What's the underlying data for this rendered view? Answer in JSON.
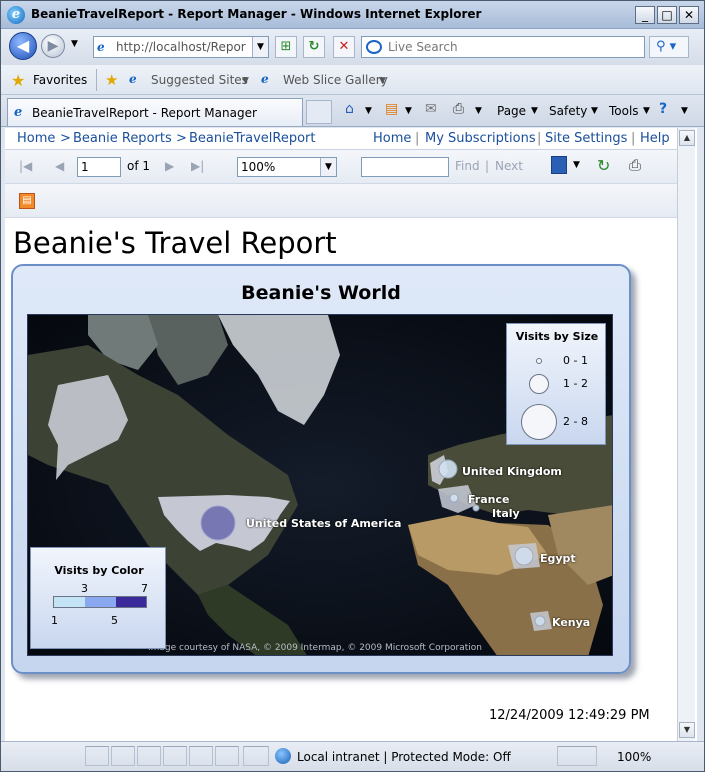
{
  "window": {
    "title": "BeanieTravelReport - Report Manager - Windows Internet Explorer"
  },
  "address_bar": {
    "url": "http://localhost/Reports,",
    "search_placeholder": "Live Search"
  },
  "favorites_bar": {
    "favorites_label": "Favorites",
    "links": [
      "Suggested Sites",
      "Web Slice Gallery"
    ]
  },
  "tab": {
    "label": "BeanieTravelReport - Report Manager"
  },
  "command_bar": {
    "page": "Page",
    "safety": "Safety",
    "tools": "Tools"
  },
  "report_manager": {
    "breadcrumb": [
      "Home",
      "Beanie Reports",
      "BeanieTravelReport"
    ],
    "breadcrumb_sep": ">",
    "links": [
      "Home",
      "My Subscriptions",
      "Site Settings",
      "Help"
    ]
  },
  "report_toolbar": {
    "page_number": "1",
    "page_of": "of 1",
    "zoom": "100%",
    "find": "Find",
    "next": "Next"
  },
  "report": {
    "title": "Beanie's Travel Report",
    "map_title": "Beanie's World",
    "countries": [
      {
        "name": "United States of America"
      },
      {
        "name": "United Kingdom"
      },
      {
        "name": "France"
      },
      {
        "name": "Italy"
      },
      {
        "name": "Egypt"
      },
      {
        "name": "Kenya"
      }
    ],
    "legend_size": {
      "title": "Visits by Size",
      "ranges": [
        "0 - 1",
        "1 - 2",
        "2 - 8"
      ]
    },
    "legend_color": {
      "title": "Visits by Color",
      "ticks_top": [
        "3",
        "7"
      ],
      "ticks_bottom": [
        "1",
        "5"
      ],
      "colors": [
        "#c4e3f4",
        "#8aa8ef",
        "#3a2a9a"
      ]
    },
    "credit": "Image courtesy of NASA, © 2009 Intermap, © 2009 Microsoft Corporation",
    "timestamp": "12/24/2009 12:49:29 PM"
  },
  "status_bar": {
    "zone": "Local intranet | Protected Mode: Off",
    "zoom": "100%"
  }
}
